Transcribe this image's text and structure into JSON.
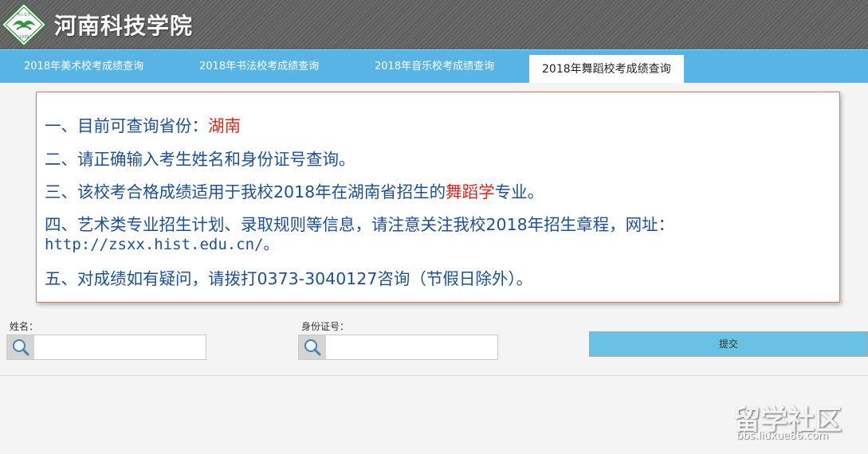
{
  "header": {
    "title": "河南科技学院",
    "logo": {
      "icon": "school-emblem-icon",
      "top_text": "H.I.S.T",
      "bottom_text": "1939"
    }
  },
  "tabs": [
    {
      "label": "2018年美术校考成绩查询",
      "active": false
    },
    {
      "label": "2018年书法校考成绩查询",
      "active": false
    },
    {
      "label": "2018年音乐校考成绩查询",
      "active": false
    },
    {
      "label": "2018年舞蹈校考成绩查询",
      "active": true
    }
  ],
  "notice": {
    "line1_prefix": "一、目前可查询省份：",
    "line1_highlight": "湖南",
    "line2": "二、请正确输入考生姓名和身份证号查询。",
    "line3_prefix": "三、该校考合格成绩适用于我校2018年在湖南省招生的",
    "line3_highlight": "舞蹈学",
    "line3_suffix": "专业。",
    "line4": "四、艺术类专业招生计划、录取规则等信息，请注意关注我校2018年招生章程，网址：",
    "line4_url": "http://zsxx.hist.edu.cn/。",
    "line5": "五、对成绩如有疑问，请拨打0373-3040127咨询（节假日除外）。"
  },
  "form": {
    "name_label": "姓名：",
    "name_value": "",
    "id_label": "身份证号：",
    "id_value": "",
    "submit_label": "提交"
  },
  "watermark": {
    "main": "留学社区",
    "sub": "bbs.liuxue86.com"
  },
  "colors": {
    "tab_bar": "#58b4e4",
    "notice_text": "#1d4f97",
    "highlight": "#d9251c",
    "notice_border": "#e8735a",
    "submit_button": "#69c2e4"
  }
}
